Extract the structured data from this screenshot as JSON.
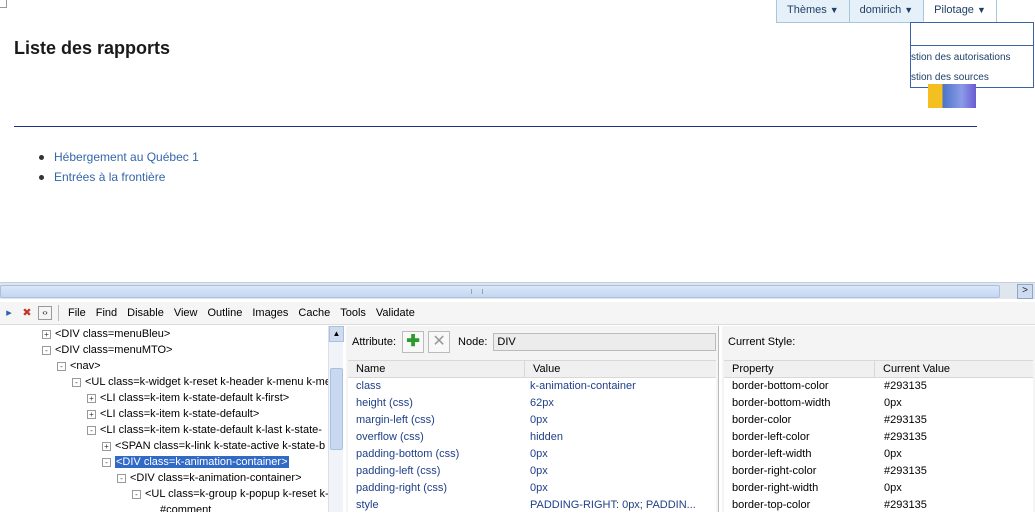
{
  "page": {
    "title": "Liste des rapports",
    "links": [
      "Hébergement au Québec 1",
      "Entrées à la frontière"
    ]
  },
  "topmenu": {
    "items": [
      {
        "label": "Thèmes",
        "caret": "▼"
      },
      {
        "label": "domirich",
        "caret": "▼"
      },
      {
        "label": "Pilotage",
        "caret": "▼"
      }
    ],
    "dropdown": [
      "stion des autorisations",
      "stion des sources"
    ]
  },
  "devtools": {
    "toolbar_menus": [
      "File",
      "Find",
      "Disable",
      "View",
      "Outline",
      "Images",
      "Cache",
      "Tools",
      "Validate"
    ],
    "scroll_right_arrow": ">",
    "tree": [
      {
        "indent": 0,
        "exp": "+",
        "text": "<DIV class=menuBleu>"
      },
      {
        "indent": 0,
        "exp": "-",
        "text": "<DIV class=menuMTO>"
      },
      {
        "indent": 1,
        "exp": "-",
        "text": "<nav>"
      },
      {
        "indent": 2,
        "exp": "-",
        "text": "<UL class=k-widget k-reset k-header k-menu k-me"
      },
      {
        "indent": 3,
        "exp": "+",
        "text": "<LI class=k-item k-state-default k-first>"
      },
      {
        "indent": 3,
        "exp": "+",
        "text": "<LI class=k-item k-state-default>"
      },
      {
        "indent": 3,
        "exp": "-",
        "text": "<LI class=k-item k-state-default k-last k-state-"
      },
      {
        "indent": 4,
        "exp": "+",
        "text": "<SPAN class=k-link k-state-active k-state-b"
      },
      {
        "indent": 4,
        "exp": "-",
        "text": "<DIV class=k-animation-container>",
        "selected": true
      },
      {
        "indent": 5,
        "exp": "-",
        "text": "<DIV class=k-animation-container>"
      },
      {
        "indent": 6,
        "exp": "-",
        "text": "<UL class=k-group k-popup k-reset k-"
      },
      {
        "indent": 7,
        "exp": "",
        "text": "#comment"
      }
    ],
    "attribute_label": "Attribute:",
    "node_label": "Node:",
    "node_value": "DIV",
    "attr_headers": {
      "name": "Name",
      "value": "Value"
    },
    "attributes": [
      {
        "name": "class",
        "value": "k-animation-container"
      },
      {
        "name": "height (css)",
        "value": "62px"
      },
      {
        "name": "margin-left (css)",
        "value": "0px"
      },
      {
        "name": "overflow (css)",
        "value": "hidden"
      },
      {
        "name": "padding-bottom (css)",
        "value": "0px"
      },
      {
        "name": "padding-left (css)",
        "value": "0px"
      },
      {
        "name": "padding-right (css)",
        "value": "0px"
      },
      {
        "name": "style",
        "value": "PADDING-RIGHT: 0px; PADDIN..."
      }
    ],
    "current_style_label": "Current Style:",
    "style_headers": {
      "property": "Property",
      "value": "Current Value"
    },
    "styles": [
      {
        "property": "border-bottom-color",
        "value": "#293135"
      },
      {
        "property": "border-bottom-width",
        "value": "0px"
      },
      {
        "property": "border-color",
        "value": "#293135"
      },
      {
        "property": "border-left-color",
        "value": "#293135"
      },
      {
        "property": "border-left-width",
        "value": "0px"
      },
      {
        "property": "border-right-color",
        "value": "#293135"
      },
      {
        "property": "border-right-width",
        "value": "0px"
      },
      {
        "property": "border-top-color",
        "value": "#293135"
      }
    ]
  },
  "colors": {
    "accent_line": "#1f2f88",
    "link": "#3366aa",
    "selection": "#3169c6"
  }
}
